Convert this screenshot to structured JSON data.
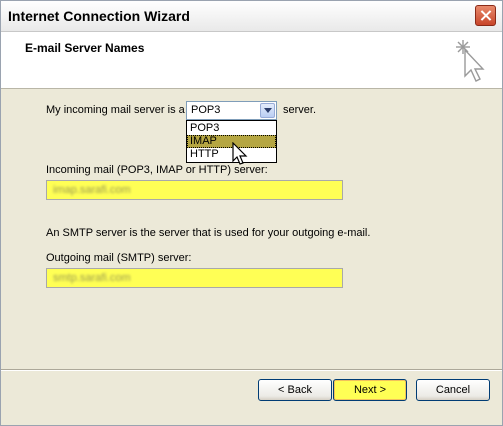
{
  "window": {
    "title": "Internet Connection Wizard",
    "header_title": "E-mail Server Names"
  },
  "incoming_row": {
    "prefix": "My incoming mail server is a",
    "selected": "POP3",
    "suffix": "server."
  },
  "dropdown": {
    "options": [
      "POP3",
      "IMAP",
      "HTTP"
    ],
    "highlighted": "IMAP"
  },
  "incoming_field": {
    "label": "Incoming mail (POP3, IMAP or HTTP) server:",
    "value": "imap.sarafi.com"
  },
  "smtp_note": "An SMTP server is the server that is used for your outgoing e-mail.",
  "outgoing_field": {
    "label": "Outgoing mail (SMTP) server:",
    "value": "smtp.sarafi.com"
  },
  "buttons": {
    "back": "< Back",
    "next": "Next >",
    "cancel": "Cancel"
  },
  "colors": {
    "field_highlight": "#ffff55",
    "selected_option": "#b5a642"
  }
}
